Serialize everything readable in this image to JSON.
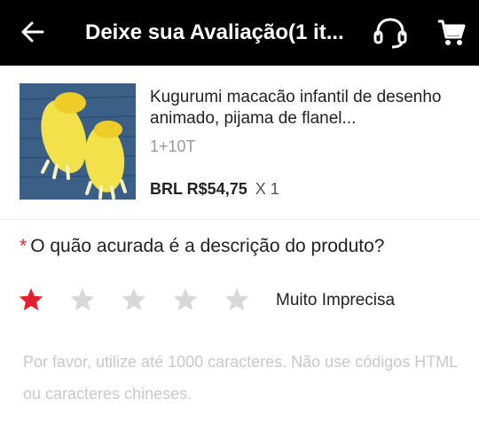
{
  "header": {
    "title": "Deixe sua Avaliação(1 it...",
    "back_icon": "back-arrow-icon",
    "support_icon": "headset-icon",
    "cart_icon": "cart-icon",
    "background": "#000000"
  },
  "product": {
    "name": "Kugurumi macacão infantil de desenho animado, pijama de flanel...",
    "variant": "1+10T",
    "price": "BRL R$54,75",
    "quantity": "X 1"
  },
  "review": {
    "required_mark": "*",
    "question": "O quão acurada é a descrição do produto?",
    "rating": 1,
    "rating_max": 5,
    "rating_label": "Muito Imprecisa",
    "star_active_color": "#e5202e",
    "star_inactive_color": "#d8d8d8"
  },
  "comment": {
    "placeholder": "Por favor, utilize até 1000 caracteres. Não use códigos HTML ou caracteres chineses."
  }
}
